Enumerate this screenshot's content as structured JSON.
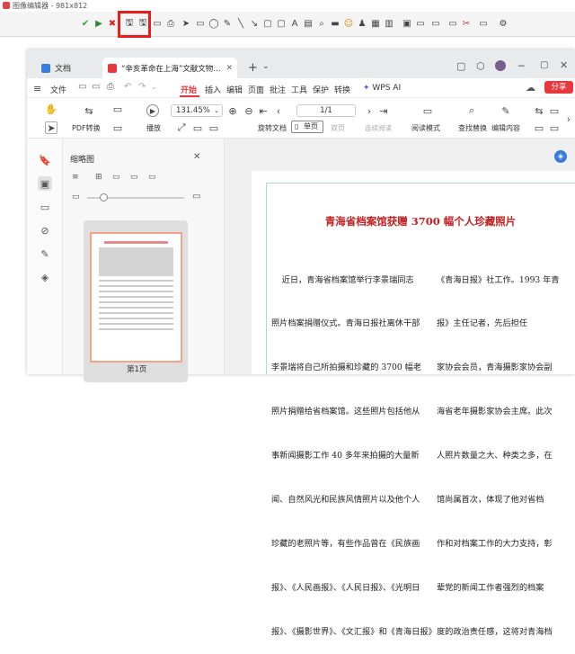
{
  "editor": {
    "title": "图像编辑器 - 981x812"
  },
  "wps": {
    "tabs": [
      {
        "label": "文档"
      },
      {
        "label": "“辛亥革命在上海”文献文物…"
      }
    ],
    "menu": {
      "file": "文件",
      "items": [
        "开始",
        "插入",
        "编辑",
        "页面",
        "批注",
        "工具",
        "保护",
        "转换"
      ],
      "ai": "WPS AI",
      "share": "分享"
    },
    "ribbon": {
      "pdf_convert": "PDF转换",
      "play": "播放",
      "zoom": "131.45%",
      "page": "1/1",
      "rotate": "旋转文档",
      "single": "单页",
      "double": "双页",
      "continuous": "连续阅读",
      "reading_mode": "阅读模式",
      "find_replace": "查找替换",
      "edit_content": "编辑内容"
    },
    "thumbnails": {
      "title": "缩略图",
      "page_label": "第1页"
    }
  },
  "document": {
    "title": "青海省档案馆获赠 3700 幅个人珍藏照片",
    "left_lines": [
      "    近日，青海省档案馆举行李景瑞同志",
      "照片档案捐赠仪式。青海日报社离休干部",
      "李景瑞将自己所拍摄和珍藏的 3700 幅老",
      "照片捐赠给省档案馆。这些照片包括他从",
      "事新闻摄影工作 40 多年来拍摄的大量新",
      "闻、自然风光和民族风情照片以及他个人",
      "珍藏的老照片等，有些作品曾在《民族画",
      "报》、《人民画报》、《人民日报》、《光明日",
      "报》、《摄影世界》、《文汇报》和《青海日报》"
    ],
    "right_lines": [
      "《青海日报》社工作。1993 年青",
      "报》主任记者，先后担任",
      "家协会会员，青海摄影家协会副",
      "海省老年摄影家协会主席。此次",
      "人照片数量之大、种类之多，在",
      "馆尚属首次，体现了他对省档",
      "作和对档案工作的大力支持，彰",
      "辈党的新闻工作者强烈的档案",
      "度的政治责任感，这将对青海档"
    ]
  }
}
